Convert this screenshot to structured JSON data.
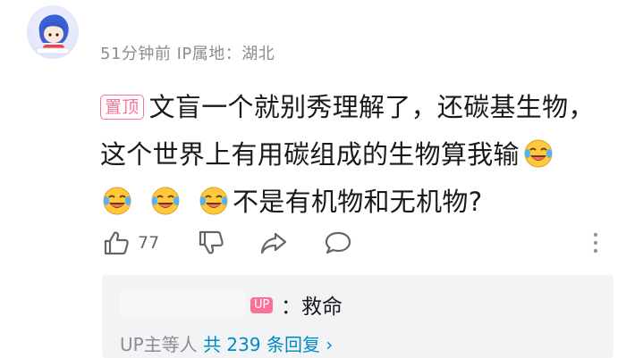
{
  "comment": {
    "meta": "51分钟前 IP属地：湖北",
    "pin_label": "置顶",
    "text_1": "文盲一个就别秀理解了，还碳基生物，",
    "text_2": "这个世界上有用碳组成的生物算我输",
    "text_3": "不是有机物和无机物?",
    "like_count": "77",
    "emoji_icon": "laugh-cry-emoji"
  },
  "reply": {
    "badge": "UP",
    "text": "：救命",
    "summary_prefix": "UP主等人",
    "summary_count": "共 239 条回复 ›"
  },
  "colors": {
    "accent": "#fb7299",
    "link": "#008ac5",
    "muted": "#8b8d92"
  }
}
